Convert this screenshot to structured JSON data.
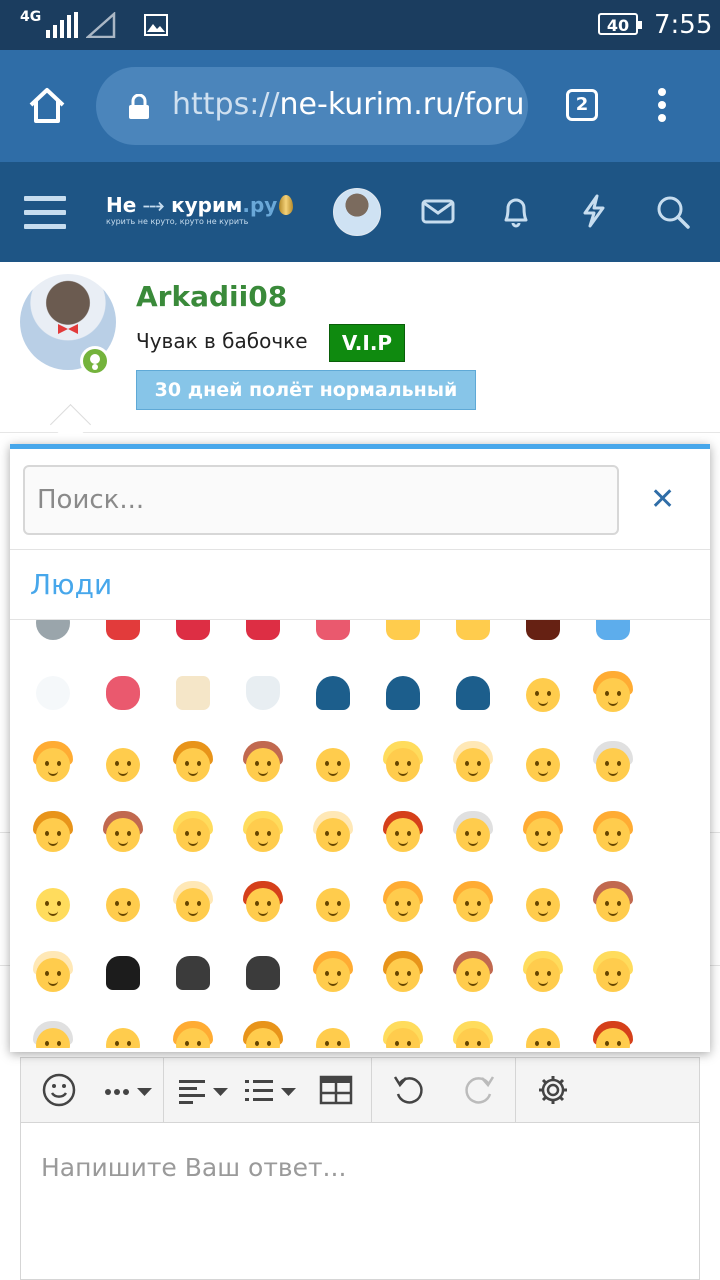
{
  "status_bar": {
    "network": "4G",
    "battery": "40",
    "time": "7:55"
  },
  "browser": {
    "url_scheme": "https://",
    "url_host": "ne-kurim.ru/foru",
    "tab_count": "2",
    "icons": [
      "home-icon",
      "lock-icon",
      "tabs-icon",
      "more-vert-icon"
    ]
  },
  "site_nav": {
    "logo_main": "Не",
    "logo_main2": "курим",
    "logo_ru": ".ру",
    "logo_tagline": "курить не круто, круто не курить",
    "icons": [
      "menu-icon",
      "avatar",
      "mail-icon",
      "bell-icon",
      "bolt-icon",
      "search-icon"
    ]
  },
  "profile": {
    "username": "Arkadii08",
    "user_title": "Чувак в бабочке",
    "badge": "V.I.P",
    "banner": "30 дней полёт нормальный",
    "colors": {
      "username": "#3a8a3a",
      "badge_bg": "#0f8a0f",
      "banner_bg": "#87c5e8"
    }
  },
  "emoji_picker": {
    "search_placeholder": "Поиск...",
    "close_symbol": "✕",
    "category_label": "Люди",
    "accent": "#47a7eb"
  },
  "editor": {
    "placeholder": "Напишите Ваш ответ...",
    "tools": [
      "smile-icon",
      "more-icon",
      "align-icon",
      "list-icon",
      "table-icon",
      "undo-icon",
      "redo-icon",
      "gear-icon"
    ]
  }
}
